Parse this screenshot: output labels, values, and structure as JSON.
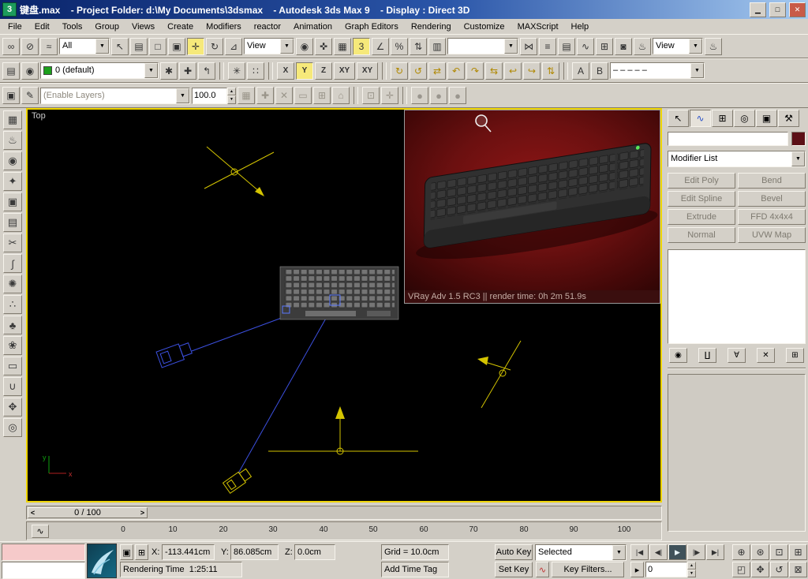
{
  "colors": {
    "titlebar_start": "#0a246a",
    "titlebar_end": "#a6caf0",
    "accent_active": "#f6e97a",
    "viewport_border": "#efd500",
    "object_color_swatch": "#5c1016",
    "layer_color": "#1ca01c",
    "render_background": "#6b1010",
    "helper_yellow": "#d4c400",
    "camera_blue": "#3c50e0"
  },
  "icons": {
    "app": "3",
    "minimize": "▁",
    "maximize": "□",
    "close": "✕",
    "chevron_down": "▼",
    "spinner_up": "▲",
    "spinner_down": "▼",
    "mini_curve_editor": "∿",
    "slider_step_back": "<",
    "slider_step_forward": ">",
    "selection_lock": "▣",
    "absolute_offset": "⊞",
    "set_key_filter": "∿",
    "key_mode": "▸"
  },
  "titlebar": {
    "title": "键盘.max    - Project Folder: d:\\My Documents\\3dsmax    - Autodesk 3ds Max 9    - Display : Direct 3D"
  },
  "menu": [
    {
      "name": "menu-file",
      "label": "File"
    },
    {
      "name": "menu-edit",
      "label": "Edit"
    },
    {
      "name": "menu-tools",
      "label": "Tools"
    },
    {
      "name": "menu-group",
      "label": "Group"
    },
    {
      "name": "menu-views",
      "label": "Views"
    },
    {
      "name": "menu-create",
      "label": "Create"
    },
    {
      "name": "menu-modifiers",
      "label": "Modifiers"
    },
    {
      "name": "menu-reactor",
      "label": "reactor"
    },
    {
      "name": "menu-animation",
      "label": "Animation"
    },
    {
      "name": "menu-graph-editors",
      "label": "Graph Editors"
    },
    {
      "name": "menu-rendering",
      "label": "Rendering"
    },
    {
      "name": "menu-customize",
      "label": "Customize"
    },
    {
      "name": "menu-maxscript",
      "label": "MAXScript"
    },
    {
      "name": "menu-help",
      "label": "Help"
    }
  ],
  "toolbar_main": [
    {
      "type": "icon",
      "name": "select-and-link-icon",
      "glyph": "∞"
    },
    {
      "type": "icon",
      "name": "unlink-selection-icon",
      "glyph": "⊘"
    },
    {
      "type": "icon",
      "name": "bind-to-space-warp-icon",
      "glyph": "≈"
    },
    {
      "type": "dropdown",
      "name": "selection-filter-dropdown",
      "value": "All",
      "cls": "w64"
    },
    {
      "type": "icon",
      "name": "select-object-icon",
      "glyph": "↖"
    },
    {
      "type": "icon",
      "name": "select-by-name-icon",
      "glyph": "▤"
    },
    {
      "type": "icon",
      "name": "rectangular-selection-icon",
      "glyph": "□"
    },
    {
      "type": "icon",
      "name": "window-crossing-icon",
      "glyph": "▣"
    },
    {
      "type": "icon",
      "name": "select-and-move-icon",
      "glyph": "✛",
      "cls": "active"
    },
    {
      "type": "icon",
      "name": "select-and-rotate-icon",
      "glyph": "↻"
    },
    {
      "type": "icon",
      "name": "select-and-scale-icon",
      "glyph": "⊿"
    },
    {
      "type": "dropdown",
      "name": "reference-coordinate-dropdown",
      "value": "View",
      "cls": "w64"
    },
    {
      "type": "icon",
      "name": "use-pivot-point-icon",
      "glyph": "◉"
    },
    {
      "type": "icon",
      "name": "select-and-manipulate-icon",
      "glyph": "✜"
    },
    {
      "type": "icon",
      "name": "keyboard-override-icon",
      "glyph": "▦"
    },
    {
      "type": "icon",
      "name": "snap-toggle-icon",
      "glyph": "3",
      "cls": "active"
    },
    {
      "type": "icon",
      "name": "angle-snap-icon",
      "glyph": "∠"
    },
    {
      "type": "icon",
      "name": "percent-snap-icon",
      "glyph": "%"
    },
    {
      "type": "icon",
      "name": "spinner-snap-icon",
      "glyph": "⇅"
    },
    {
      "type": "icon",
      "name": "named-selection-sets-icon",
      "glyph": "▥"
    },
    {
      "type": "dropdown",
      "name": "named-selection-dropdown",
      "value": "",
      "cls": "w90"
    },
    {
      "type": "icon",
      "name": "mirror-icon",
      "glyph": "⋈"
    },
    {
      "type": "icon",
      "name": "align-icon",
      "glyph": "≡"
    },
    {
      "type": "icon",
      "name": "layer-manager-icon",
      "glyph": "▤"
    },
    {
      "type": "icon",
      "name": "curve-editor-icon",
      "glyph": "∿"
    },
    {
      "type": "icon",
      "name": "schematic-view-icon",
      "glyph": "⊞"
    },
    {
      "type": "icon",
      "name": "material-editor-icon",
      "glyph": "◙"
    },
    {
      "type": "icon",
      "name": "render-scene-icon",
      "glyph": "♨"
    },
    {
      "type": "dropdown",
      "name": "render-type-dropdown",
      "value": "View",
      "cls": "w64"
    },
    {
      "type": "icon",
      "name": "quick-render-icon",
      "glyph": "♨"
    }
  ],
  "toolbar_row2": [
    {
      "type": "icon",
      "name": "layer-manager-toggle-icon",
      "glyph": "▤"
    },
    {
      "type": "icon",
      "name": "layer-visibility-icon",
      "glyph": "◉"
    },
    {
      "type": "dropdown",
      "name": "active-layer-dropdown",
      "value": "0 (default)",
      "cls": "w150 has-swatch"
    },
    {
      "type": "icon",
      "name": "create-layer-icon",
      "glyph": "✱"
    },
    {
      "type": "icon",
      "name": "add-to-layer-icon",
      "glyph": "✚"
    },
    {
      "type": "icon",
      "name": "select-layer-icon",
      "glyph": "↰"
    },
    {
      "type": "divider"
    },
    {
      "type": "icon",
      "name": "array-icon",
      "glyph": "✳"
    },
    {
      "type": "icon",
      "name": "spacing-tool-icon",
      "glyph": "∷"
    },
    {
      "type": "divider"
    },
    {
      "type": "icon",
      "name": "restrict-x-button",
      "glyph": "X",
      "cls": "axis"
    },
    {
      "type": "icon",
      "name": "restrict-y-button",
      "glyph": "Y",
      "cls": "axis active"
    },
    {
      "type": "icon",
      "name": "restrict-z-button",
      "glyph": "Z",
      "cls": "axis"
    },
    {
      "type": "icon",
      "name": "restrict-xy-button",
      "glyph": "XY",
      "cls": "axis wide"
    },
    {
      "type": "icon",
      "name": "restrict-plane-flyout-button",
      "glyph": "XY",
      "cls": "axis wide"
    },
    {
      "type": "divider"
    },
    {
      "type": "icon",
      "name": "macro-rotate-cw-icon",
      "glyph": "↻",
      "cls": "yellow"
    },
    {
      "type": "icon",
      "name": "macro-rotate-ccw-icon",
      "glyph": "↺",
      "cls": "yellow"
    },
    {
      "type": "icon",
      "name": "macro-swap-icon",
      "glyph": "⇄",
      "cls": "yellow"
    },
    {
      "type": "icon",
      "name": "macro-undo-view-icon",
      "glyph": "↶",
      "cls": "yellow"
    },
    {
      "type": "icon",
      "name": "macro-redo-view-icon",
      "glyph": "↷",
      "cls": "yellow"
    },
    {
      "type": "icon",
      "name": "macro-shift-icon",
      "glyph": "⇆",
      "cls": "yellow"
    },
    {
      "type": "icon",
      "name": "macro-return-icon",
      "glyph": "↩",
      "cls": "yellow"
    },
    {
      "type": "icon",
      "name": "macro-forward-icon",
      "glyph": "↪",
      "cls": "yellow"
    },
    {
      "type": "icon",
      "name": "macro-cycle-icon",
      "glyph": "⇅",
      "cls": "yellow"
    },
    {
      "type": "divider"
    },
    {
      "type": "icon",
      "name": "tool-a-icon",
      "glyph": "A"
    },
    {
      "type": "icon",
      "name": "tool-b-icon",
      "glyph": "B"
    },
    {
      "type": "dropdown",
      "name": "line-style-dropdown",
      "value": "– – – – –",
      "cls": "w120"
    }
  ],
  "toolbar_row3": [
    {
      "type": "icon",
      "name": "enable-anim-layers-icon",
      "glyph": "▣"
    },
    {
      "type": "icon",
      "name": "select-anim-layer-icon",
      "glyph": "✎"
    },
    {
      "type": "dropdown",
      "name": "anim-layers-dropdown",
      "value": "(Enable Layers)",
      "cls": "w190 disabled"
    },
    {
      "type": "spinner",
      "name": "layer-weight-spinner",
      "value": "100.0"
    },
    {
      "type": "icon",
      "name": "anim-layer-list-icon",
      "glyph": "▦",
      "cls": "disabled"
    },
    {
      "type": "icon",
      "name": "add-anim-layer-icon",
      "glyph": "✚",
      "cls": "disabled"
    },
    {
      "type": "icon",
      "name": "delete-anim-layer-icon",
      "glyph": "✕",
      "cls": "disabled"
    },
    {
      "type": "icon",
      "name": "copy-anim-layer-icon",
      "glyph": "▭",
      "cls": "disabled"
    },
    {
      "type": "icon",
      "name": "paste-anim-layer-icon",
      "glyph": "⊞",
      "cls": "disabled"
    },
    {
      "type": "icon",
      "name": "collapse-anim-layer-icon",
      "glyph": "⌂",
      "cls": "disabled"
    },
    {
      "type": "divider"
    },
    {
      "type": "icon",
      "name": "disable-anim-layer-icon",
      "glyph": "⊡",
      "cls": "disabled"
    },
    {
      "type": "icon",
      "name": "anim-layer-props-icon",
      "glyph": "✛",
      "cls": "disabled"
    },
    {
      "type": "divider"
    },
    {
      "type": "icon",
      "name": "indicator-sphere-icon",
      "glyph": "●",
      "cls": "ball"
    },
    {
      "type": "icon",
      "name": "indicator-sphere-icon",
      "glyph": "●",
      "cls": "ball"
    },
    {
      "type": "icon",
      "name": "indicator-sphere-icon",
      "glyph": "●",
      "cls": "ball"
    }
  ],
  "left_tools": [
    {
      "name": "box-primitive-icon",
      "glyph": "▦"
    },
    {
      "name": "teapot-icon",
      "glyph": "♨"
    },
    {
      "name": "sphere-icon",
      "glyph": "◉"
    },
    {
      "name": "star-icon",
      "glyph": "✦"
    },
    {
      "name": "display-panel-icon",
      "glyph": "▣"
    },
    {
      "name": "layers-panel-icon",
      "glyph": "▤"
    },
    {
      "name": "scissors-icon",
      "glyph": "✂"
    },
    {
      "name": "spline-icon",
      "glyph": "∫"
    },
    {
      "name": "gear-icon",
      "glyph": "✺"
    },
    {
      "name": "scatter-icon",
      "glyph": "∴"
    },
    {
      "name": "tree-icon",
      "glyph": "♣"
    },
    {
      "name": "flower-icon",
      "glyph": "❀"
    },
    {
      "name": "cylinder-icon",
      "glyph": "▭"
    },
    {
      "name": "tube-icon",
      "glyph": "∪"
    },
    {
      "name": "move-gizmo-icon",
      "glyph": "✥"
    },
    {
      "name": "camera-icon",
      "glyph": "◎"
    }
  ],
  "viewport": {
    "label": "Top"
  },
  "render_window": {
    "caption": "VRay Adv 1.5 RC3 || render time: 0h 2m 51.9s"
  },
  "command_panel": {
    "tabs": [
      {
        "name": "create-tab",
        "glyph": "↖"
      },
      {
        "name": "modify-tab",
        "glyph": "∿",
        "cls": "active blue"
      },
      {
        "name": "hierarchy-tab",
        "glyph": "⊞"
      },
      {
        "name": "motion-tab",
        "glyph": "◎"
      },
      {
        "name": "display-tab",
        "glyph": "▣"
      },
      {
        "name": "utilities-tab",
        "glyph": "⚒"
      }
    ],
    "object_name_value": "",
    "modifier_list_label": "Modifier List",
    "modifier_buttons": [
      {
        "name": "edit-poly-button",
        "label": "Edit Poly"
      },
      {
        "name": "bend-button",
        "label": "Bend"
      },
      {
        "name": "edit-spline-button",
        "label": "Edit Spline"
      },
      {
        "name": "bevel-button",
        "label": "Bevel"
      },
      {
        "name": "extrude-button",
        "label": "Extrude"
      },
      {
        "name": "ffd-4x4x4-button",
        "label": "FFD 4x4x4"
      },
      {
        "name": "normal-button",
        "label": "Normal"
      },
      {
        "name": "uvw-map-button",
        "label": "UVW Map"
      }
    ],
    "stack_tools": [
      {
        "name": "pin-stack-icon",
        "glyph": "◉"
      },
      {
        "name": "show-end-result-icon",
        "glyph": "∐"
      },
      {
        "name": "make-unique-icon",
        "glyph": "∀"
      },
      {
        "name": "remove-modifier-icon",
        "glyph": "✕"
      },
      {
        "name": "configure-modifier-sets-icon",
        "glyph": "⊞"
      }
    ]
  },
  "timeline": {
    "slider_label": "0 / 100",
    "ticks": [
      {
        "label": "0",
        "cls": "t0"
      },
      {
        "label": "10",
        "cls": "t1"
      },
      {
        "label": "20",
        "cls": "t2"
      },
      {
        "label": "30",
        "cls": "t3"
      },
      {
        "label": "40",
        "cls": "t4"
      },
      {
        "label": "50",
        "cls": "t5"
      },
      {
        "label": "60",
        "cls": "t6"
      },
      {
        "label": "70",
        "cls": "t7"
      },
      {
        "label": "80",
        "cls": "t8"
      },
      {
        "label": "90",
        "cls": "t9"
      },
      {
        "label": "100",
        "cls": "t10"
      }
    ]
  },
  "vcr": [
    {
      "name": "go-to-start-button",
      "glyph": "|◀"
    },
    {
      "name": "previous-frame-button",
      "glyph": "◀|"
    },
    {
      "name": "play-button",
      "glyph": "▶",
      "cls": "dark"
    },
    {
      "name": "next-frame-button",
      "glyph": "|▶"
    },
    {
      "name": "go-to-end-button",
      "glyph": "▶|"
    }
  ],
  "nav_row1": [
    {
      "name": "zoom-icon",
      "glyph": "⊕"
    },
    {
      "name": "zoom-all-icon",
      "glyph": "⊛"
    },
    {
      "name": "zoom-extents-icon",
      "glyph": "⊡"
    },
    {
      "name": "zoom-extents-all-icon",
      "glyph": "⊞"
    }
  ],
  "nav_row2": [
    {
      "name": "zoom-region-icon",
      "glyph": "◰"
    },
    {
      "name": "pan-icon",
      "glyph": "✥"
    },
    {
      "name": "arc-rotate-icon",
      "glyph": "↺"
    },
    {
      "name": "maximize-viewport-icon",
      "glyph": "⊠"
    }
  ],
  "status": {
    "x_label": "X:",
    "x_value": "-113.441cm",
    "y_label": "Y:",
    "y_value": "86.085cm",
    "z_label": "Z:",
    "z_value": "0.0cm",
    "grid_label": "Grid = 10.0cm",
    "prompt": "Rendering Time  1:25:11",
    "add_time_tag": "Add Time Tag",
    "auto_key": "Auto Key",
    "set_key": "Set Key",
    "selection_set": "Selected",
    "key_filters": "Key Filters...",
    "frame_value": "0"
  }
}
